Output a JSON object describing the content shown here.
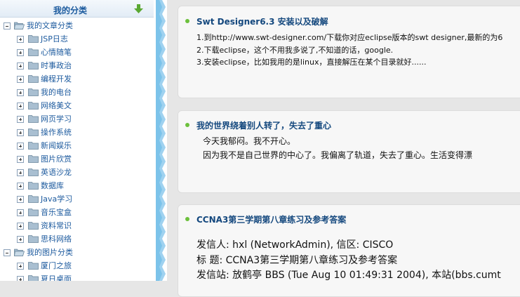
{
  "sidebar": {
    "title": "我的分类",
    "collapse_icon": "green-down-arrow-icon",
    "groups": [
      {
        "label": "我的文章分类",
        "items": [
          "JSP日志",
          "心情随笔",
          "时事政治",
          "编程开发",
          "我的电台",
          "网络美文",
          "网页学习",
          "操作系统",
          "新闻娱乐",
          "图片欣赏",
          "英语沙龙",
          "数据库",
          "Java学习",
          "音乐宝盒",
          "资料常识",
          "思科网络"
        ]
      },
      {
        "label": "我的图片分类",
        "items": [
          "厦门之旅",
          "夏日桌面"
        ]
      }
    ]
  },
  "colors": {
    "accent": "#1c5a9e",
    "bullet": "#6cc03c",
    "background": "#e6e6e6"
  },
  "posts": [
    {
      "title": "Swt Designer6.3 安装以及破解",
      "lines": [
        "1.到http://www.swt-designer.com/下载你对应eclipse版本的swt designer,最新的为6",
        "2.下载eclipse，这个不用我多说了,不知道的话，google.",
        "3.安装eclipse，比如我用的是linux，直接解压在某个目录就好......"
      ]
    },
    {
      "title": "我的世界绕着别人转了，失去了重心",
      "lines": [
        "今天我郁闷。我不开心。",
        "因为我不是自己世界的中心了。我偏离了轨道，失去了重心。生活变得漂"
      ]
    },
    {
      "title": "CCNA3第三学期第八章练习及参考答案",
      "lines": [
        "发信人: hxl (NetworkAdmin), 信区: CISCO",
        "标  题: CCNA3第三学期第八章练习及参考答案",
        "发信站: 放鹤亭 BBS (Tue Aug 10 01:49:31 2004), 本站(bbs.cumt"
      ]
    }
  ]
}
